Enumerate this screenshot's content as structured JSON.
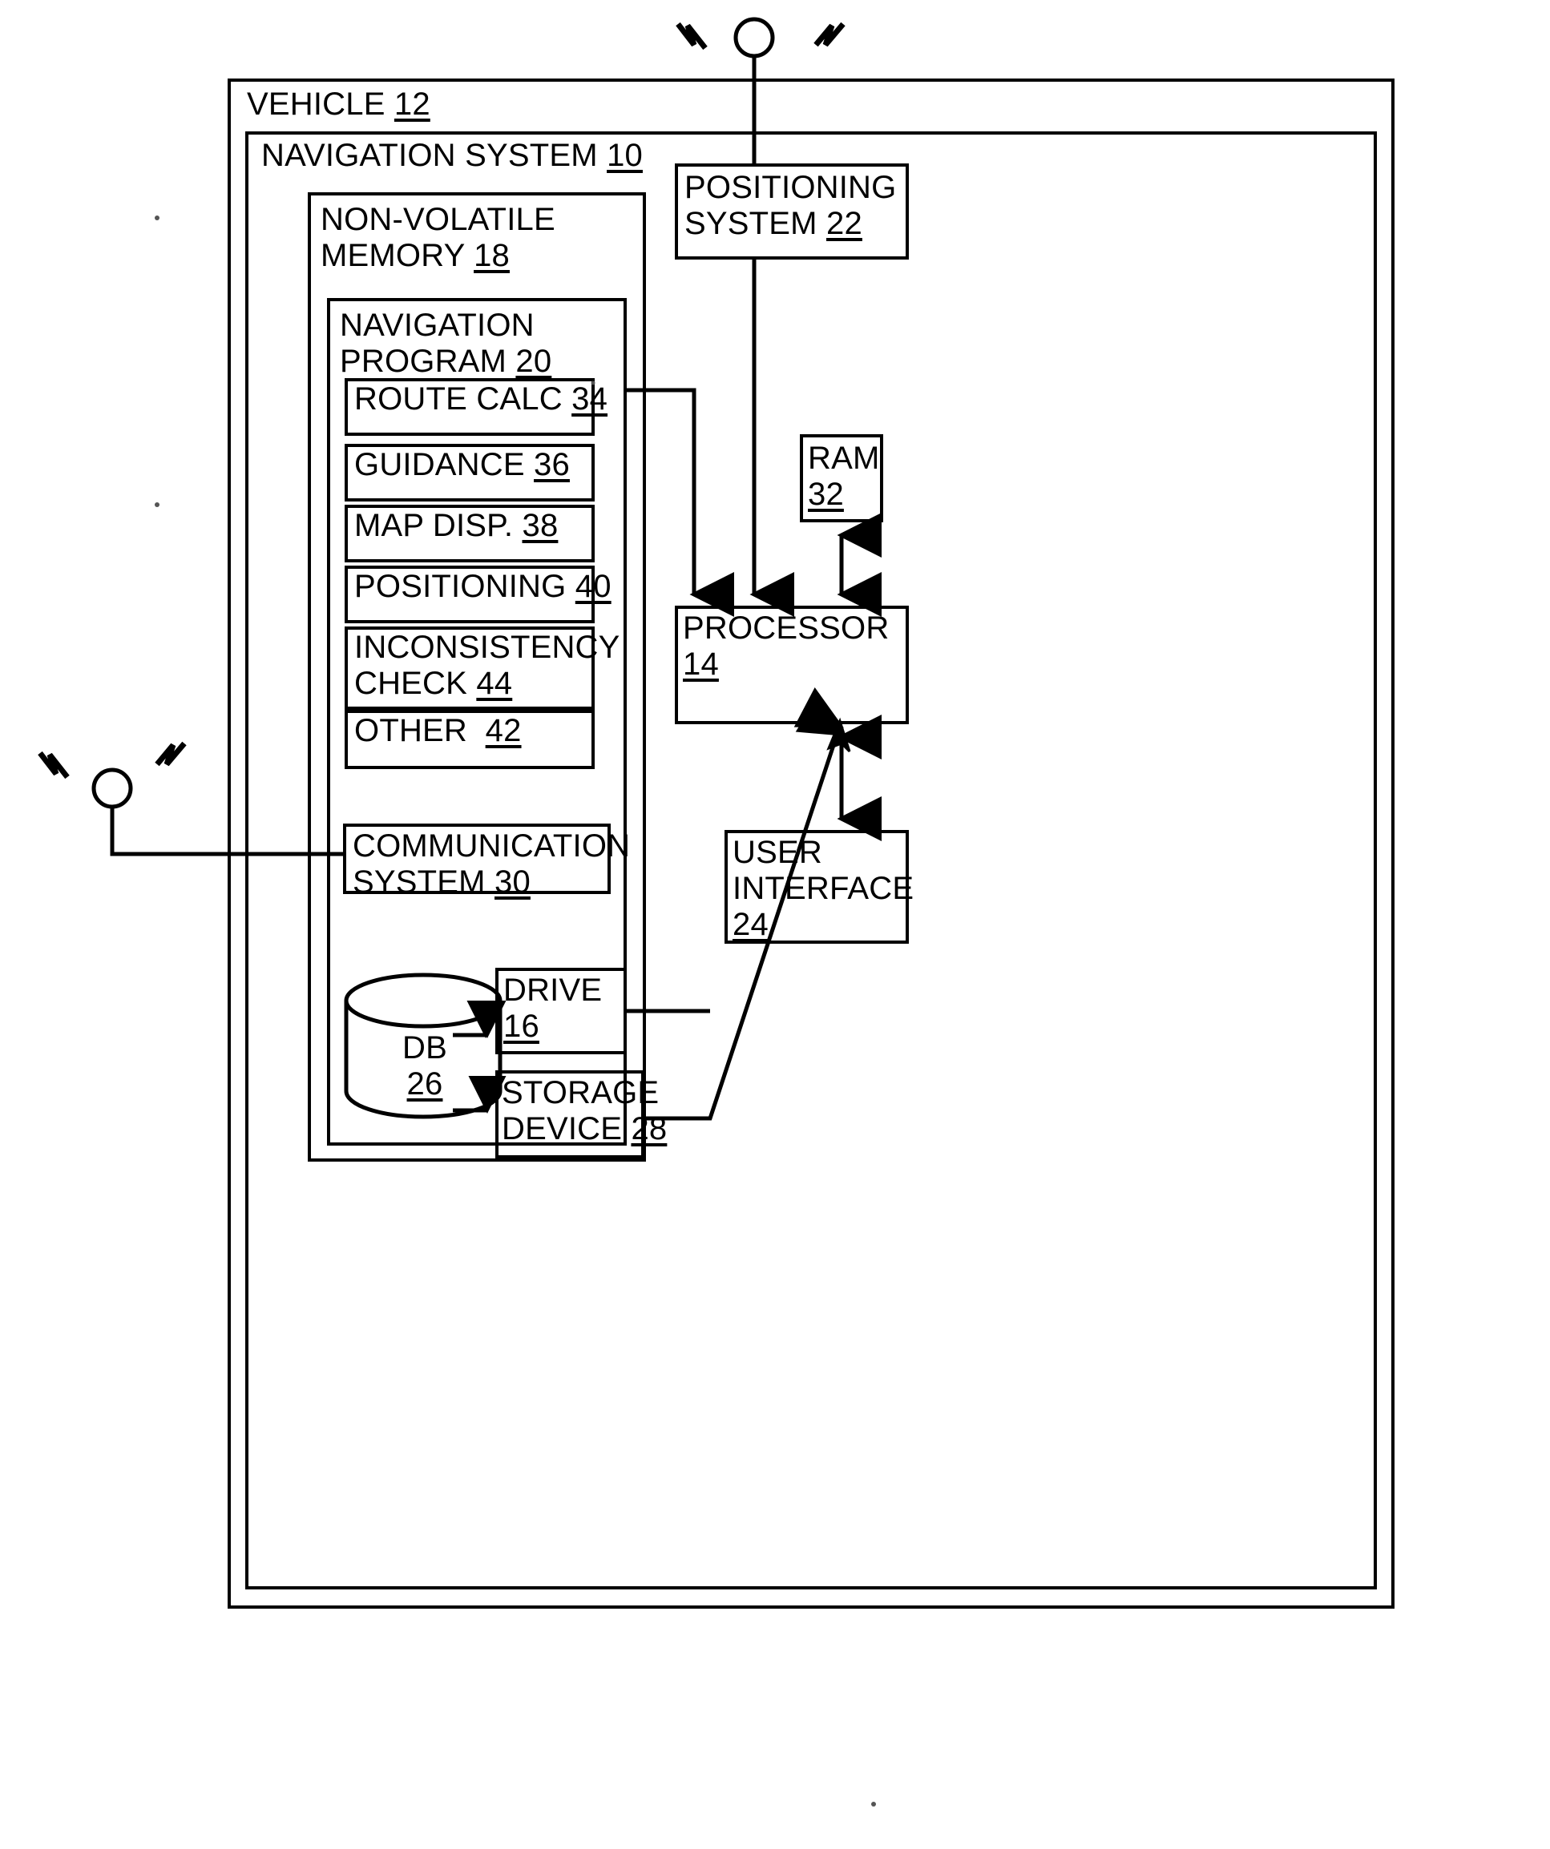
{
  "figure": {
    "type": "patent-block-diagram",
    "description": "Vehicle navigation system block diagram"
  },
  "blocks": {
    "vehicle": {
      "label": "VEHICLE ",
      "ref": "12"
    },
    "nav_system": {
      "label": "NAVIGATION SYSTEM ",
      "ref": "10"
    },
    "nonvolatile_memory": {
      "line1": "NON-VOLATILE",
      "line2": "MEMORY ",
      "ref": "18"
    },
    "nav_program": {
      "line1": "NAVIGATION",
      "line2": "PROGRAM ",
      "ref": "20"
    },
    "route_calc": {
      "label": "ROUTE CALC ",
      "ref": "34"
    },
    "guidance": {
      "label": "GUIDANCE ",
      "ref": "36"
    },
    "map_disp": {
      "label": "MAP DISP. ",
      "ref": "38"
    },
    "positioning_module": {
      "label": "POSITIONING ",
      "ref": "40"
    },
    "inconsistency_check": {
      "line1": "INCONSISTENCY",
      "line2": "CHECK ",
      "ref": "44"
    },
    "other": {
      "label": "OTHER  ",
      "ref": "42"
    },
    "positioning_system": {
      "line1": "POSITIONING",
      "line2": "SYSTEM ",
      "ref": "22"
    },
    "ram": {
      "line1": "RAM",
      "line2": "",
      "ref": "32"
    },
    "processor": {
      "line1": "PROCESSOR",
      "line2": "",
      "ref": "14"
    },
    "user_interface": {
      "line1": "USER",
      "line2": "INTERFACE",
      "ref": "24"
    },
    "communication_system": {
      "line1": "COMMUNICATION",
      "line2": "SYSTEM ",
      "ref": "30"
    },
    "drive": {
      "line1": "DRIVE",
      "ref": "16"
    },
    "storage_device": {
      "line1": "STORAGE",
      "line2": "DEVICE ",
      "ref": "28"
    },
    "database": {
      "label": "DB",
      "ref": "26"
    }
  },
  "icons": {
    "antenna_top": "antenna-icon",
    "antenna_left": "antenna-icon",
    "cylinder": "database-cylinder-icon"
  },
  "colors": {
    "line": "#000000",
    "background": "#ffffff"
  },
  "connections": [
    {
      "from": "antenna_top",
      "to": "positioning_system",
      "arrow": "none"
    },
    {
      "from": "positioning_system",
      "to": "processor",
      "arrow": "end"
    },
    {
      "from": "nav_program",
      "to": "processor",
      "arrow": "end"
    },
    {
      "from": "ram",
      "to": "processor",
      "arrow": "both"
    },
    {
      "from": "processor",
      "to": "user_interface",
      "arrow": "both"
    },
    {
      "from": "antenna_left",
      "to": "communication_system",
      "arrow": "none"
    },
    {
      "from": "database",
      "to": "drive",
      "arrow": "end"
    },
    {
      "from": "database",
      "to": "storage_device",
      "arrow": "end"
    },
    {
      "from": "storage_device",
      "to": "processor",
      "arrow": "end"
    },
    {
      "from": "drive",
      "to": "storage_processor_link",
      "arrow": "none"
    }
  ]
}
